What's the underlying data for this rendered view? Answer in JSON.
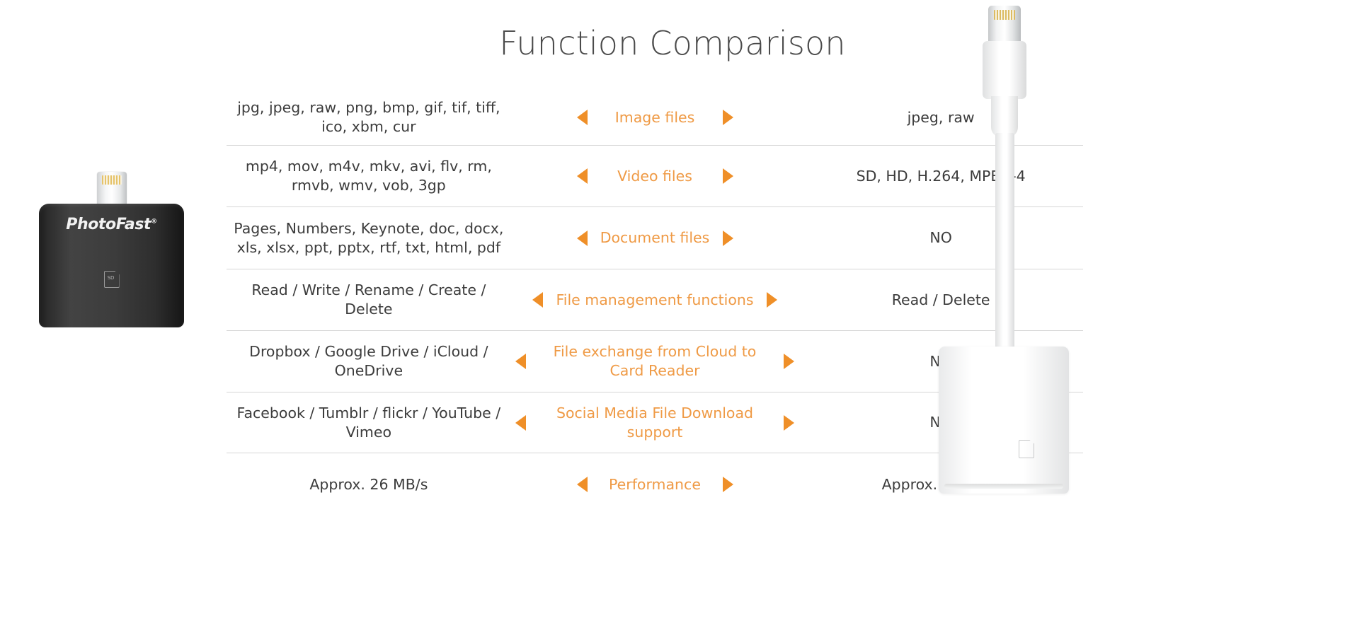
{
  "page": {
    "title": "Function Comparison"
  },
  "colors": {
    "accent": "#ef9a45",
    "arrow": "#ef8f28",
    "text": "#3c3c3c",
    "divider": "#d6d6d6"
  },
  "products": {
    "left": {
      "name": "PhotoFast lightning SD card reader",
      "brand": "PhotoFast",
      "trademark": "®",
      "slot_label": "SD"
    },
    "right": {
      "name": "Apple Lightning to SD Card Camera Reader"
    }
  },
  "comparison": {
    "rows": [
      {
        "feature": "Image files",
        "left": "jpg, jpeg, raw, png, bmp, gif, tif, tiff, ico, xbm, cur",
        "right": "jpeg, raw"
      },
      {
        "feature": "Video files",
        "left": "mp4, mov, m4v, mkv, avi, flv, rm, rmvb, wmv, vob, 3gp",
        "right": "SD, HD, H.264, MPEG-4"
      },
      {
        "feature": "Document files",
        "left": "Pages, Numbers, Keynote, doc, docx, xls, xlsx, ppt, pptx, rtf, txt, html, pdf",
        "right": "NO"
      },
      {
        "feature": "File management functions",
        "left": "Read / Write / Rename / Create / Delete",
        "right": "Read / Delete"
      },
      {
        "feature": "File exchange from Cloud to Card Reader",
        "left": "Dropbox / Google Drive / iCloud / OneDrive",
        "right": "NO"
      },
      {
        "feature": "Social Media File Download support",
        "left": "Facebook / Tumblr / flickr / YouTube / Vimeo",
        "right": "NO"
      },
      {
        "feature": "Performance",
        "left": "Approx. 26 MB/s",
        "right": "Approx. 12 MB/s"
      }
    ]
  }
}
